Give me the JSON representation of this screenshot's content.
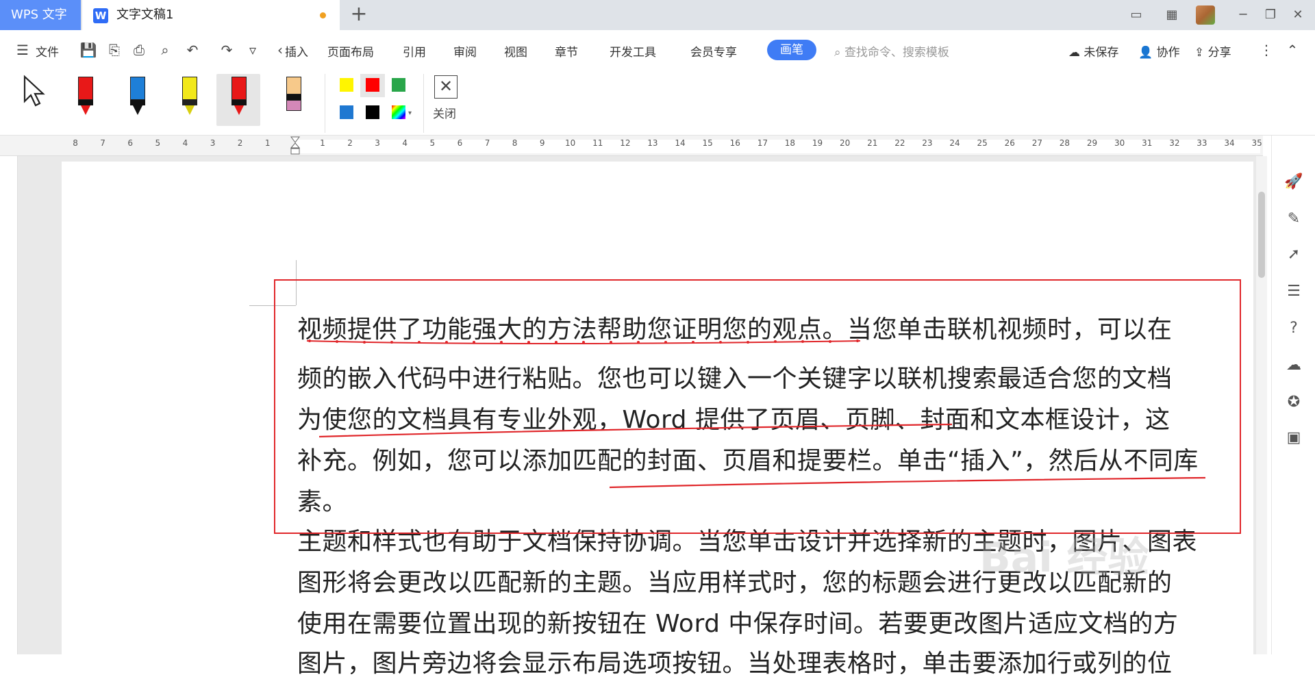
{
  "titlebar": {
    "app_tab": "WPS 文字",
    "doc_tab": "文字文稿1",
    "new_tab": "+"
  },
  "menubar": {
    "file": "文件",
    "items": [
      "插入",
      "页面布局",
      "引用",
      "审阅",
      "视图",
      "章节",
      "开发工具",
      "会员专享"
    ],
    "active": "画笔",
    "search_placeholder": "查找命令、搜索模板",
    "unsaved": "未保存",
    "collab": "协作",
    "share": "分享"
  },
  "pentools": {
    "pens": [
      {
        "name": "red",
        "color": "#e81818"
      },
      {
        "name": "blue",
        "color": "#1e7fd8"
      },
      {
        "name": "yellow",
        "color": "#f2e81a"
      },
      {
        "name": "red-selected",
        "color": "#e81818"
      },
      {
        "name": "eraser",
        "color": "#f7c98a"
      }
    ],
    "swatches": [
      "#fff500",
      "#ff0000",
      "#29a64a",
      "#1f78d1",
      "#000000",
      "rainbow"
    ],
    "close_label": "关闭"
  },
  "ruler": {
    "left": [
      "8",
      "7",
      "6",
      "5",
      "4",
      "3",
      "2",
      "1"
    ],
    "right": [
      "1",
      "2",
      "3",
      "4",
      "5",
      "6",
      "7",
      "8",
      "9",
      "10",
      "11",
      "12",
      "13",
      "14",
      "15",
      "16",
      "17",
      "18",
      "19",
      "20",
      "21",
      "22",
      "23",
      "24",
      "25",
      "26",
      "27",
      "28",
      "29",
      "30",
      "31",
      "32",
      "33",
      "34",
      "35"
    ]
  },
  "document": {
    "lines": [
      "视频提供了功能强大的方法帮助您证明您的观点。当您单击联机视频时，可以在",
      "频的嵌入代码中进行粘贴。您也可以键入一个关键字以联机搜索最适合您的文档",
      "为使您的文档具有专业外观，Word 提供了页眉、页脚、封面和文本框设计，这",
      "补充。例如，您可以添加匹配的封面、页眉和提要栏。单击“插入”，然后从不同库",
      "素。",
      "主题和样式也有助于文档保持协调。当您单击设计并选择新的主题时，图片、图表",
      "图形将会更改以匹配新的主题。当应用样式时，您的标题会进行更改以匹配新的",
      "使用在需要位置出现的新按钮在 Word 中保存时间。若要更改图片适应文档的方",
      "图片，图片旁边将会显示布局选项按钮。当处理表格时，单击要添加行或列的位"
    ]
  },
  "colors": {
    "accent": "#3f7cf5",
    "ink_red": "#e0262a"
  }
}
